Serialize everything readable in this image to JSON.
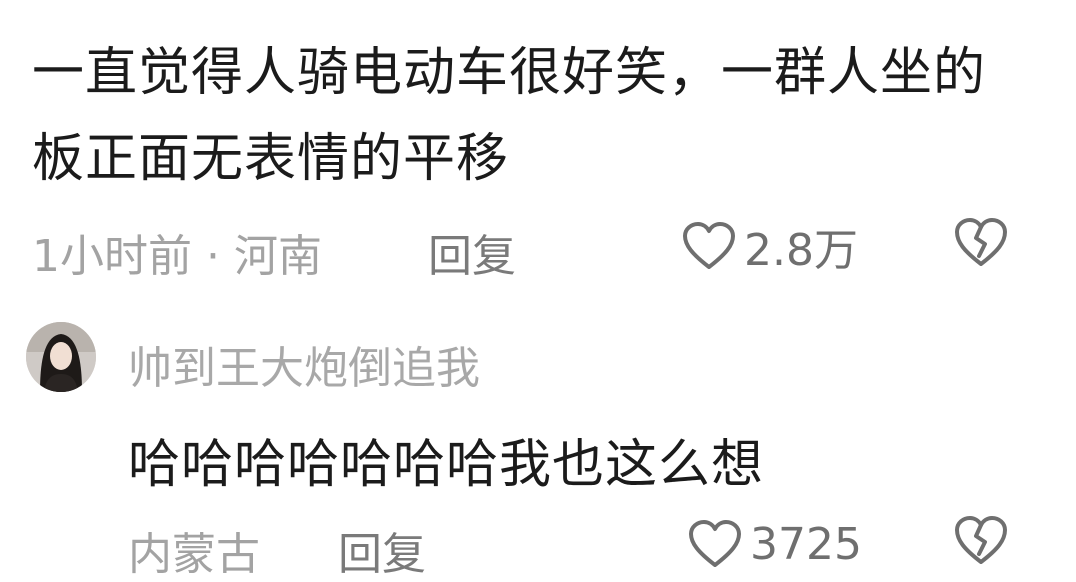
{
  "comment": {
    "text": "一直觉得人骑电动车很好笑，一群人坐的板正面无表情的平移",
    "meta": "1小时前 · 河南",
    "reply_label": "回复",
    "like_count": "2.8万"
  },
  "reply": {
    "username": "帅到王大炮倒追我",
    "text": "哈哈哈哈哈哈哈我也这么想",
    "location": "内蒙古",
    "reply_label": "回复",
    "like_count": "3725"
  },
  "icons": {
    "like": "heart-outline-icon",
    "dislike": "broken-heart-icon"
  },
  "colors": {
    "text_primary": "#1b1b1b",
    "text_secondary": "#a3a3a3",
    "icon_gray": "#6f6f6f"
  }
}
